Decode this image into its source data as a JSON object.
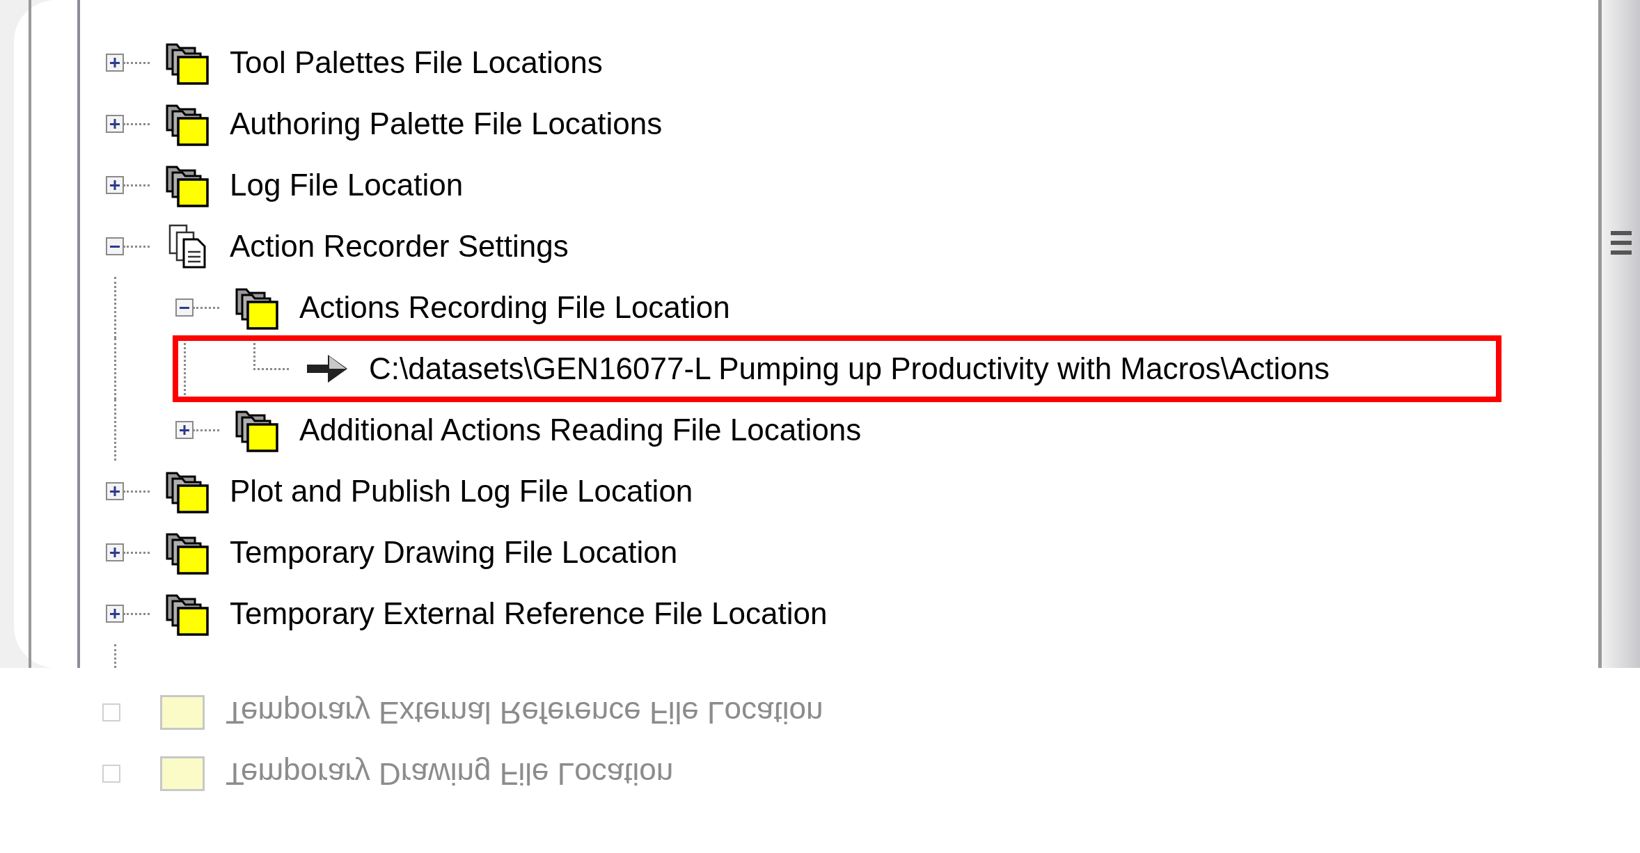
{
  "tree": {
    "items": [
      {
        "kind": "folder",
        "label": "Tool Palettes File Locations",
        "expanded": false
      },
      {
        "kind": "folder",
        "label": "Authoring Palette File Locations",
        "expanded": false
      },
      {
        "kind": "folder",
        "label": "Log File Location",
        "expanded": false
      },
      {
        "kind": "settings",
        "label": "Action Recorder Settings",
        "expanded": true,
        "children": [
          {
            "kind": "folder",
            "label": "Actions Recording File Location",
            "expanded": true,
            "children": [
              {
                "kind": "path",
                "label": "C:\\datasets\\GEN16077-L Pumping up Productivity with Macros\\Actions",
                "highlighted": true
              }
            ]
          },
          {
            "kind": "folder",
            "label": "Additional Actions Reading File Locations",
            "expanded": false
          }
        ]
      },
      {
        "kind": "folder",
        "label": "Plot and Publish Log File Location",
        "expanded": false
      },
      {
        "kind": "folder",
        "label": "Temporary Drawing File Location",
        "expanded": false
      },
      {
        "kind": "folder",
        "label": "Temporary External Reference File Location",
        "expanded": false
      }
    ]
  },
  "reflection": {
    "items": [
      "Temporary External Reference File Location",
      "Temporary Drawing File Location"
    ]
  }
}
